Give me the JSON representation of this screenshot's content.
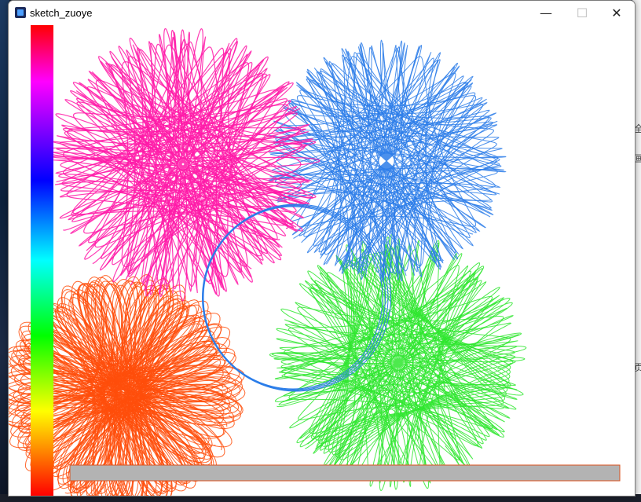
{
  "window": {
    "title": "sketch_zuoye",
    "minimize_glyph": "—",
    "maximize_glyph": "☐",
    "close_glyph": "✕"
  },
  "desktop_right_glyphs": [
    "全",
    "画",
    "页"
  ],
  "palette": {
    "gradient_stops": [
      "#ff0000",
      "#ff00ff",
      "#0000ff",
      "#00ffff",
      "#00ff00",
      "#ffff00",
      "#ff0000"
    ]
  },
  "drawing": {
    "spirographs": [
      {
        "name": "magenta-spirograph",
        "color": "#ff1aa8"
      },
      {
        "name": "blue-spirograph",
        "color": "#2b7de9"
      },
      {
        "name": "green-spirograph",
        "color": "#2ee62e"
      },
      {
        "name": "orange-spirograph",
        "color": "#ff4d0a"
      },
      {
        "name": "blue-ring",
        "color": "#2b7de9"
      }
    ]
  },
  "bottom_bar": {
    "fill": "#b3b3b3",
    "border": "#d9501c"
  }
}
